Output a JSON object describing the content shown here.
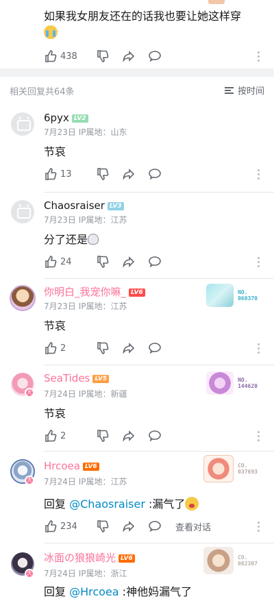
{
  "top_comment": {
    "text": "如果我女朋友还在的话我也要让她这样穿",
    "emoji": "loudly-crying-face-icon",
    "likes": "438"
  },
  "replies_header": {
    "count_label": "相关回复共64条",
    "sort_label": "按时间",
    "sort_icon": "list-sort-icon"
  },
  "replies": [
    {
      "username": "6pyx",
      "level": "LV2",
      "meta": "7月23日 IP属地：山东",
      "content": "节哀",
      "likes": "13",
      "avatar": "default-tv-avatar"
    },
    {
      "username": "Chaosraiser",
      "level": "LV3",
      "meta": "7月23日 IP属地：江苏",
      "content": "分了还是",
      "emoji": "skull-crossbones-icon",
      "likes": "24",
      "avatar": "default-tv-avatar"
    },
    {
      "username": "你明白_我宠你嘛_",
      "level": "LV6",
      "meta": "7月23日 IP属地：江苏",
      "content": "节哀",
      "likes": "2",
      "decor_number": "NO.\n060370"
    },
    {
      "username": "SeaTides",
      "level": "LV5",
      "meta": "7月24日 IP属地：新疆",
      "content": "节哀",
      "likes": "2",
      "decor_number": "NO.\n144620"
    },
    {
      "username": "Hrcoea",
      "level": "LV6",
      "meta": "7月24日 IP属地：江苏",
      "reply_prefix": "回复 ",
      "mention": "@Chaosraiser",
      "content": " :漏气了",
      "emoji": "anxious-sweat-face-icon",
      "likes": "234",
      "view_conversation": "查看对话",
      "decor_number": "CO.\n037693"
    },
    {
      "username": "冰面の狼狼崎光",
      "level": "LV6",
      "meta": "7月24日 IP属地：浙江",
      "reply_prefix": "回复 ",
      "mention": "@Hrcoea",
      "content": " :神他妈漏气了",
      "decor_number": "CO.\n082307"
    }
  ],
  "colors": {
    "vip_pink": "#fb7299",
    "mention_blue": "#008ac5",
    "lv2": "#95ddb2",
    "lv3": "#92d1e5",
    "lv6": "#ff6c00"
  }
}
